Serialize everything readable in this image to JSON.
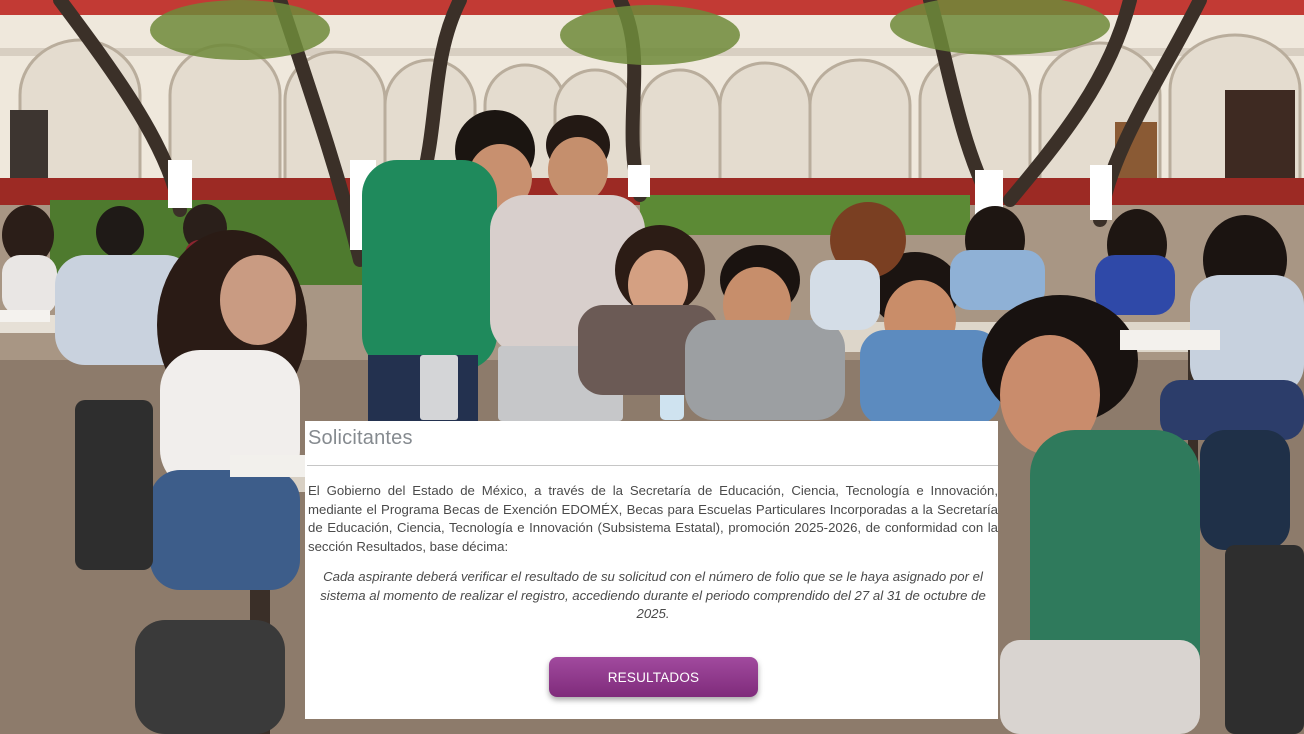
{
  "card": {
    "title": "Solicitantes",
    "body": "El Gobierno del Estado de México, a través de la Secretaría de Educación, Ciencia, Tecnología e Innovación, mediante el Programa Becas de Exención EDOMÉX, Becas para Escuelas Particulares Incorporadas a la Secretaría de Educación, Ciencia, Tecnología e Innovación (Subsistema Estatal), promoción 2025-2026, de conformidad con la sección Resultados, base décima:",
    "note": "Cada aspirante deberá verificar el resultado de su solicitud con el número de folio que se le haya asignado por el sistema al momento de realizar el registro, accediendo durante el periodo comprendido del 27 al 31 de octubre de 2025.",
    "button_label": "RESULTADOS"
  },
  "colors": {
    "button": "#8e3a8b",
    "title": "#858a8f",
    "text": "#4a4a4a",
    "roof": "#c23a34",
    "wall": "#efe8dc",
    "wainscot": "#9c2a24"
  }
}
